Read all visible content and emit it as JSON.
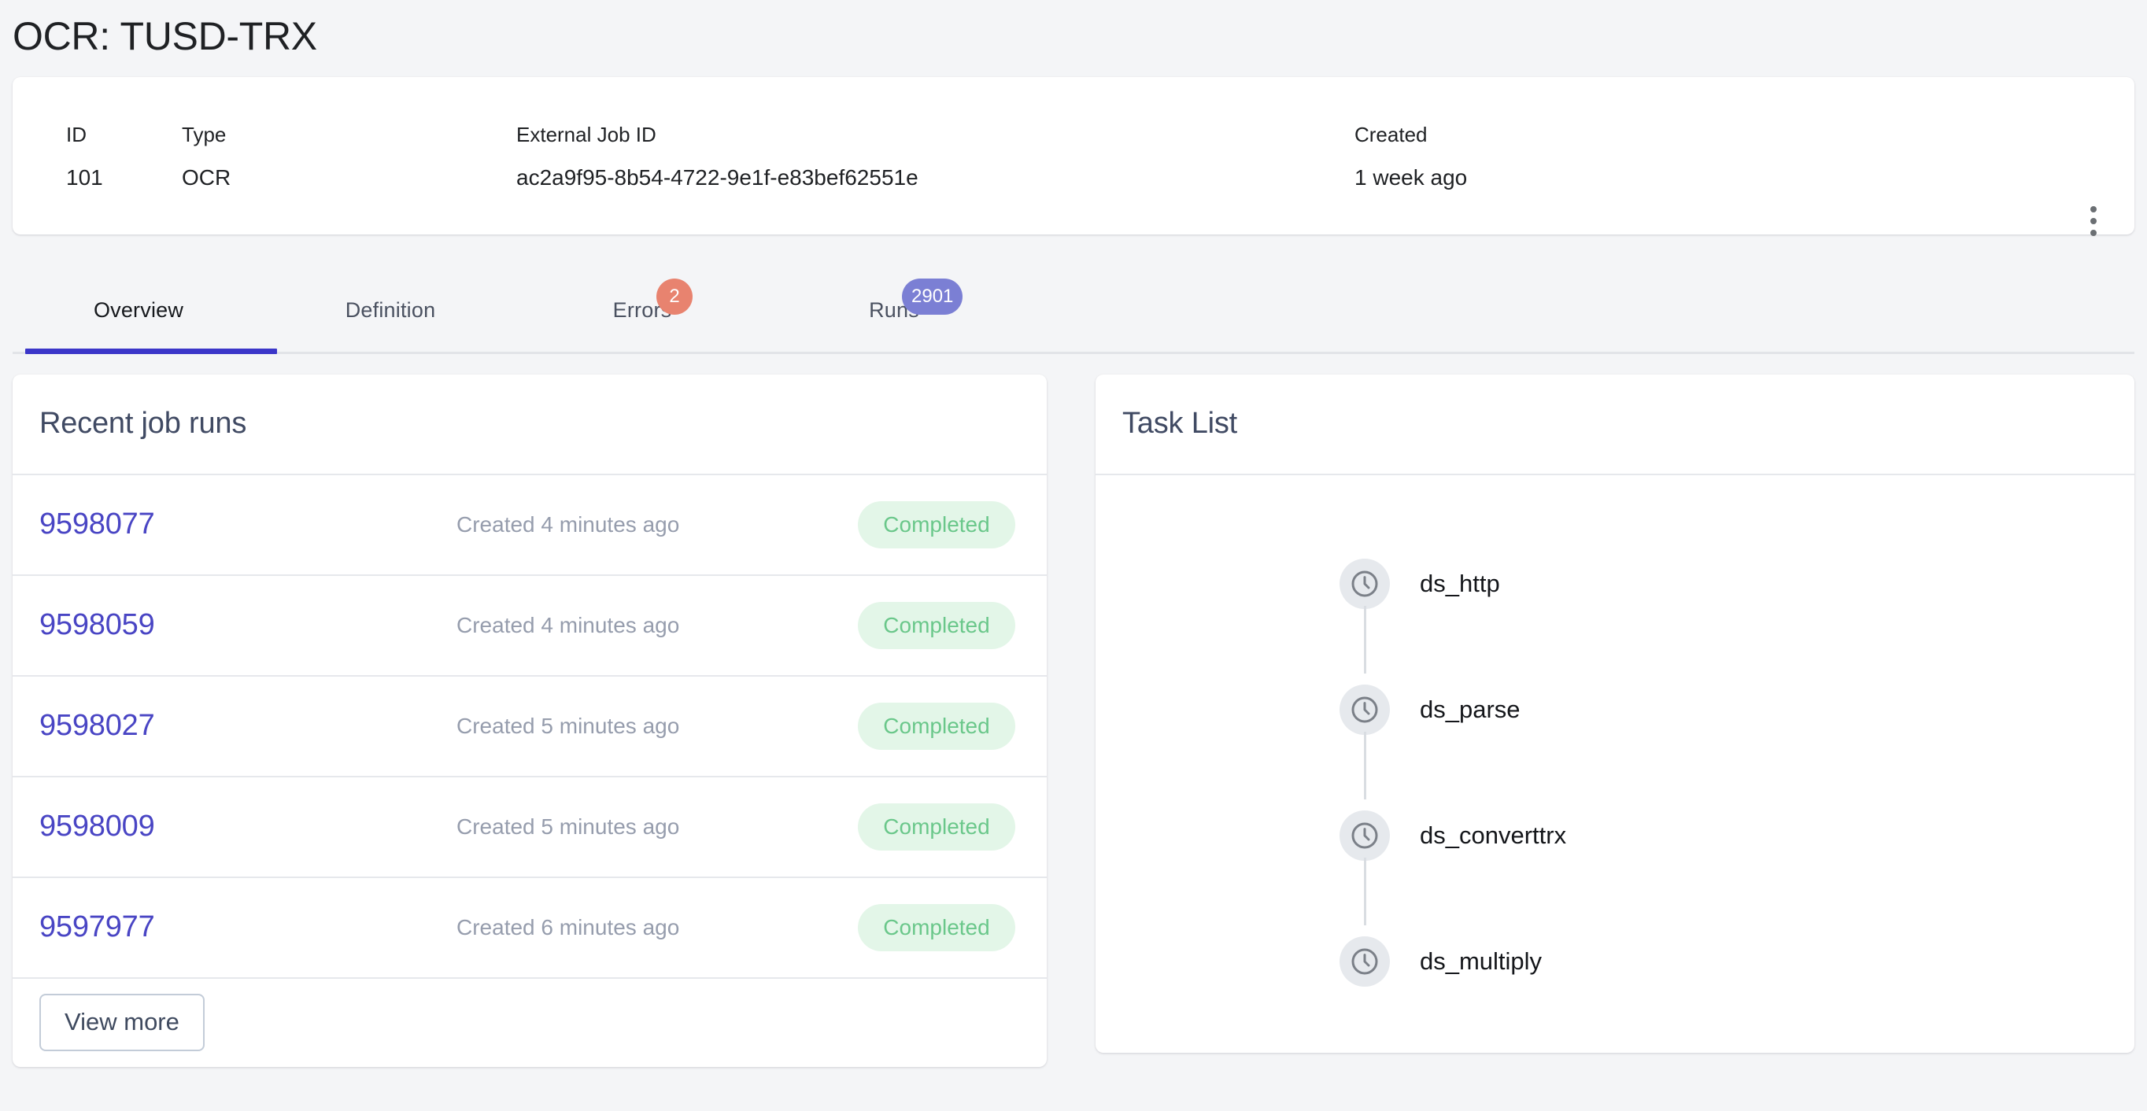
{
  "page": {
    "title": "OCR: TUSD-TRX",
    "background_color": "#f4f5f7"
  },
  "summary_card": {
    "fields": [
      {
        "label": "ID",
        "value": "101"
      },
      {
        "label": "Type",
        "value": "OCR"
      },
      {
        "label": "External Job ID",
        "value": "ac2a9f95-8b54-4722-9e1f-e83bef62551e"
      },
      {
        "label": "Created",
        "value": "1 week ago"
      }
    ],
    "menu_icon": "kebab-menu-icon"
  },
  "tabs": {
    "active": "Overview",
    "active_color": "#3b36c9",
    "items": [
      {
        "label": "Overview",
        "badge": null,
        "badge_color": null
      },
      {
        "label": "Definition",
        "badge": null,
        "badge_color": null
      },
      {
        "label": "Errors",
        "badge": "2",
        "badge_color": "#e8836f"
      },
      {
        "label": "Runs",
        "badge": "2901",
        "badge_color": "#7b7fd4"
      }
    ]
  },
  "recent_job_runs": {
    "title": "Recent job runs",
    "rows": [
      {
        "id": "9598077",
        "created": "Created 4 minutes ago",
        "status": "Completed"
      },
      {
        "id": "9598059",
        "created": "Created 4 minutes ago",
        "status": "Completed"
      },
      {
        "id": "9598027",
        "created": "Created 5 minutes ago",
        "status": "Completed"
      },
      {
        "id": "9598009",
        "created": "Created 5 minutes ago",
        "status": "Completed"
      },
      {
        "id": "9597977",
        "created": "Created 6 minutes ago",
        "status": "Completed"
      }
    ],
    "view_more_label": "View more",
    "status_color": "#6ac78a",
    "status_background": "#e3f6e8",
    "link_color": "#4945c4"
  },
  "task_list": {
    "title": "Task List",
    "tasks": [
      {
        "name": "ds_http",
        "icon": "clock-icon"
      },
      {
        "name": "ds_parse",
        "icon": "clock-icon"
      },
      {
        "name": "ds_converttrx",
        "icon": "clock-icon"
      },
      {
        "name": "ds_multiply",
        "icon": "clock-icon"
      }
    ]
  }
}
